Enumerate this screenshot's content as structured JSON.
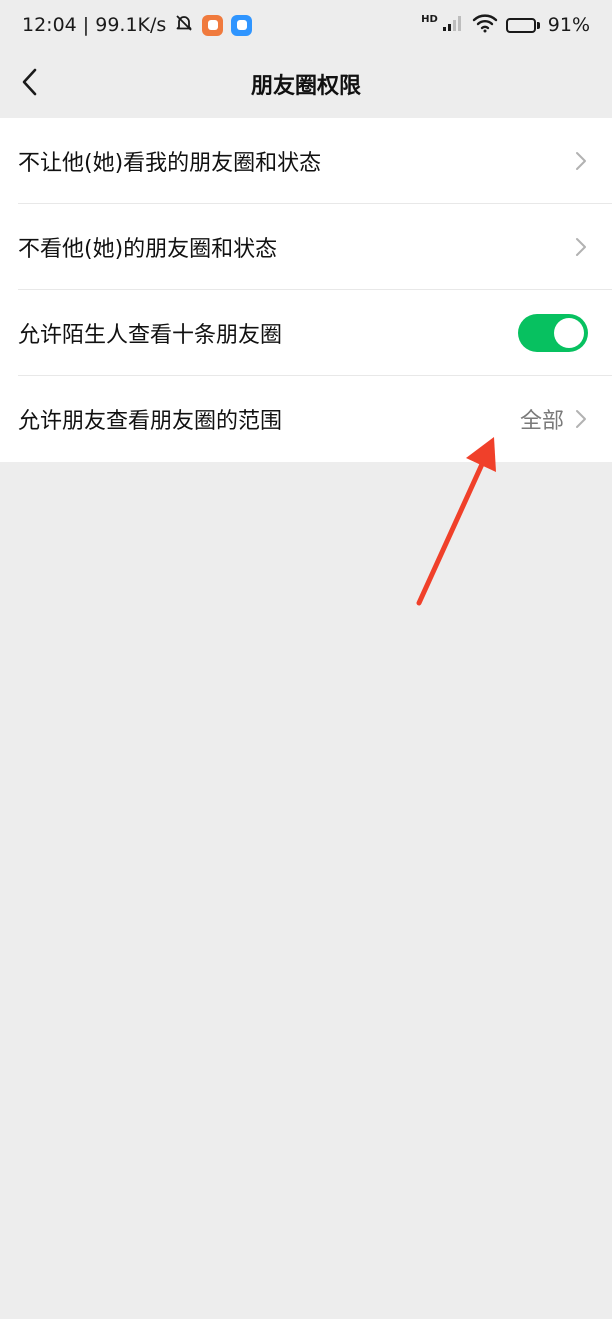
{
  "status_bar": {
    "time_speed": "12:04 | 99.1K/s",
    "hd": "HD",
    "battery": "91%",
    "battery_level": 0.91
  },
  "nav": {
    "title": "朋友圈权限"
  },
  "settings": [
    {
      "label": "不让他(她)看我的朋友圈和状态"
    },
    {
      "label": "不看他(她)的朋友圈和状态"
    },
    {
      "label": "允许陌生人查看十条朋友圈",
      "toggle_on": true
    },
    {
      "label": "允许朋友查看朋友圈的范围",
      "value": "全部"
    }
  ],
  "colors": {
    "toggle_on": "#07c160",
    "annotation_arrow": "#f0402a",
    "background": "#ededed"
  }
}
